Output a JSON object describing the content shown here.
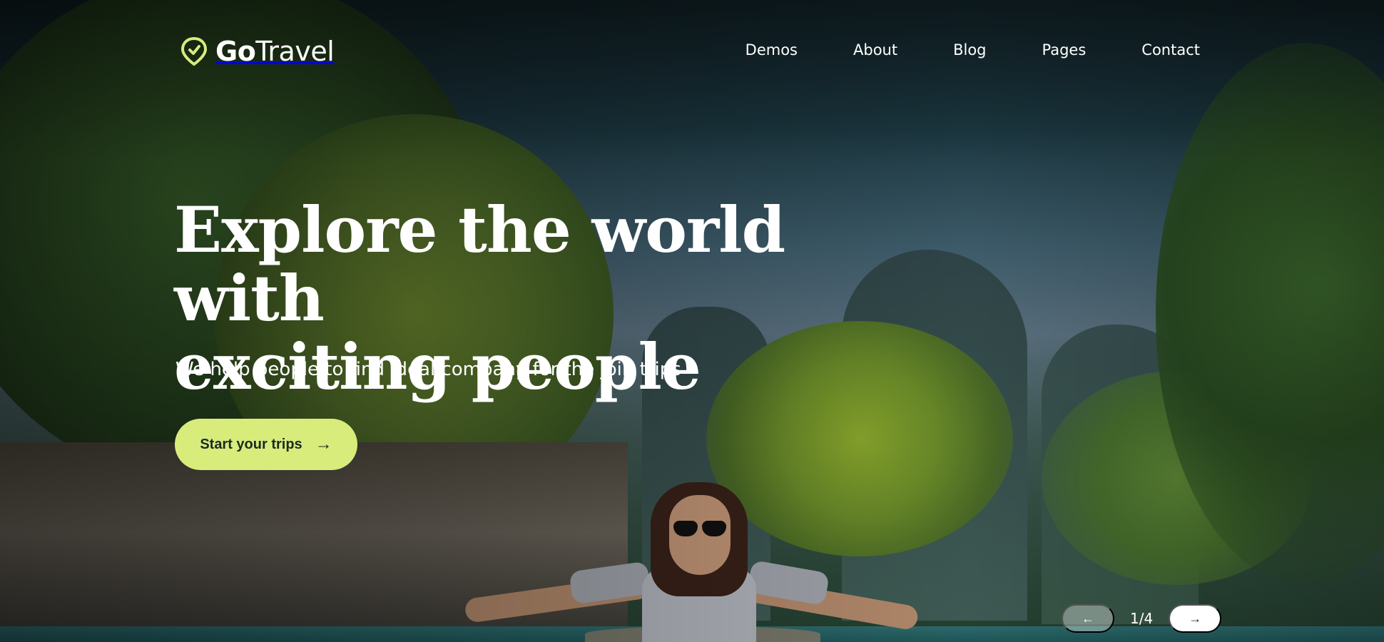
{
  "brand": {
    "name_bold": "Go",
    "name_rest": "Travel",
    "accent": "#d8ec7c"
  },
  "nav": {
    "items": [
      {
        "label": "Demos"
      },
      {
        "label": "About"
      },
      {
        "label": "Blog"
      },
      {
        "label": "Pages"
      },
      {
        "label": "Contact"
      }
    ]
  },
  "hero": {
    "headline_line1": "Explore the world with",
    "headline_line2": "exciting people",
    "subtitle": "We help people to find ideal company for the join trips",
    "cta_label": "Start your trips",
    "cta_icon": "arrow-right-icon"
  },
  "slider": {
    "counter": "1/4",
    "prev_icon": "arrow-left-icon",
    "next_icon": "arrow-right-icon"
  }
}
